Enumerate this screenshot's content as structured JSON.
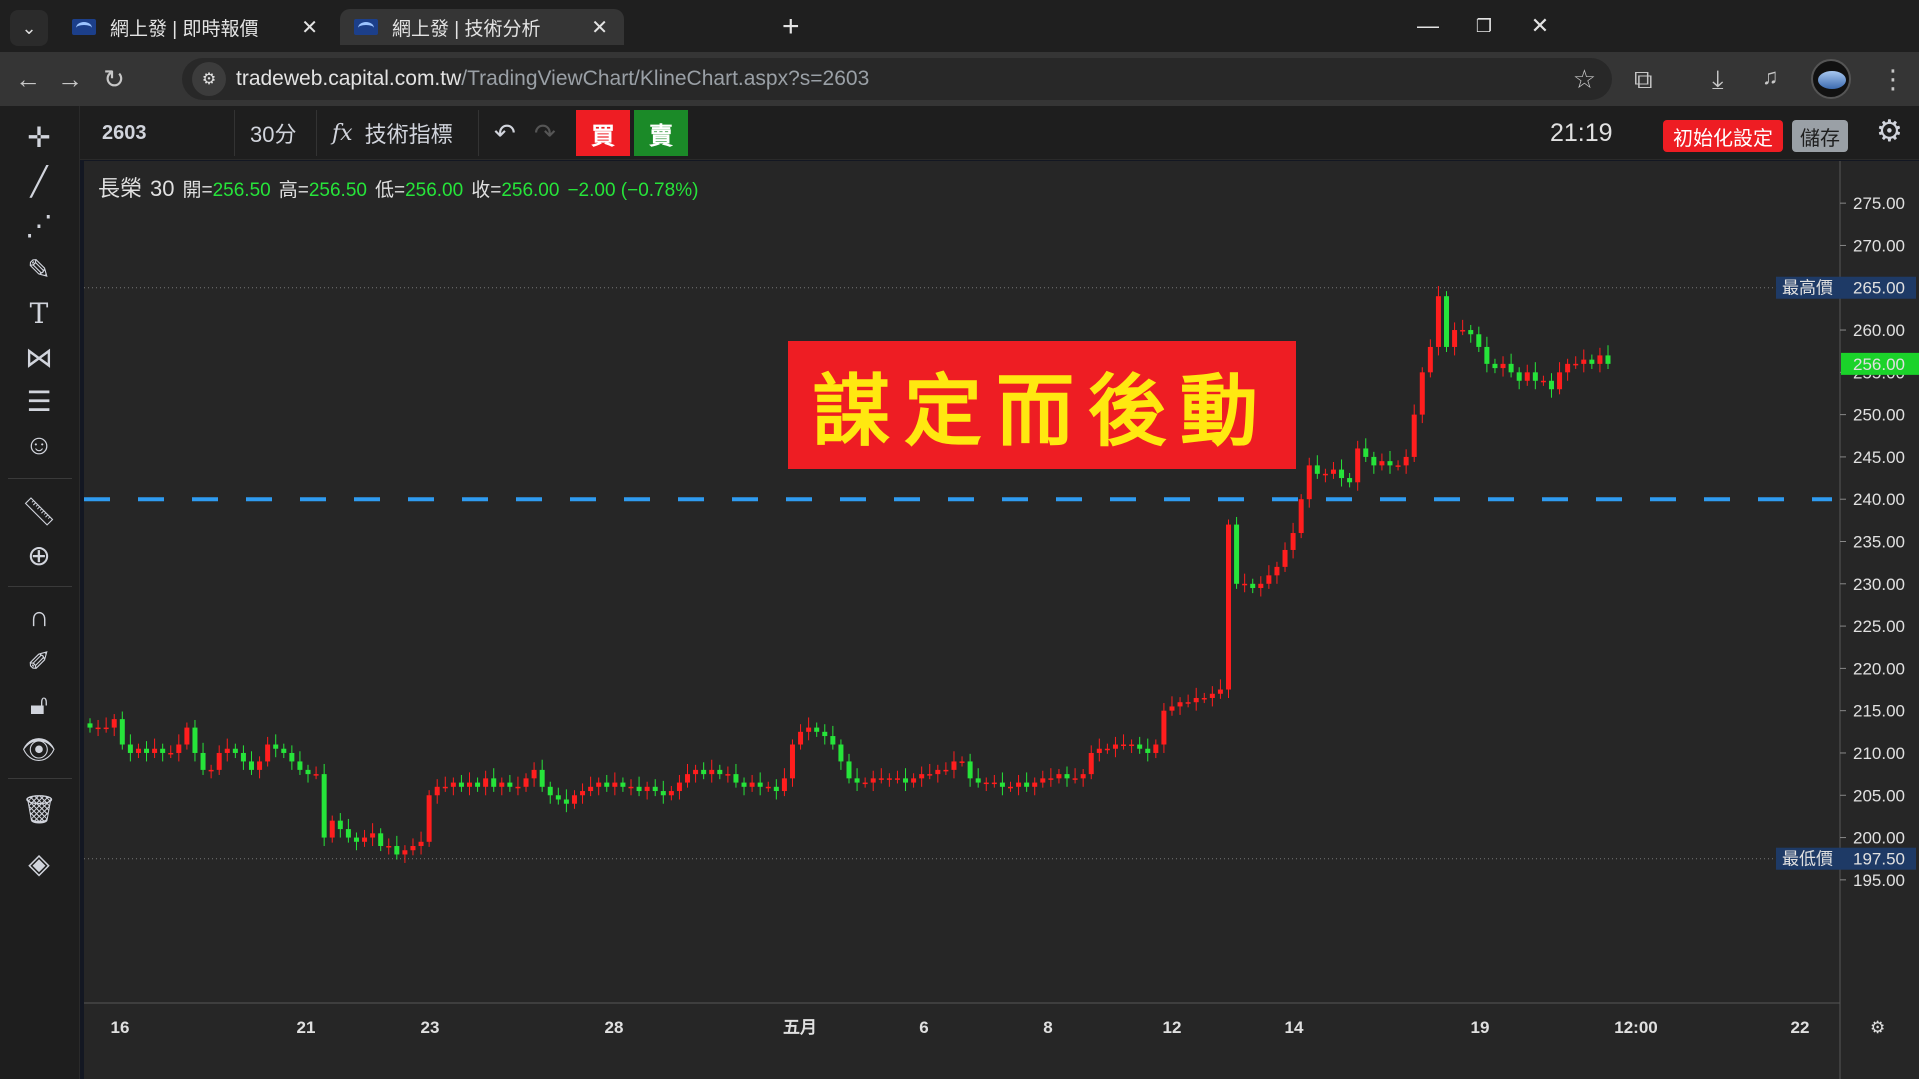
{
  "browser": {
    "tabs": [
      {
        "title": "網上發 | 即時報價",
        "active": false
      },
      {
        "title": "網上發 | 技術分析",
        "active": true
      }
    ],
    "url_host": "tradeweb.capital.com.tw",
    "url_path": "/TradingViewChart/KlineChart.aspx?s=2603"
  },
  "toolbar": {
    "symbol": "2603",
    "interval": "30分",
    "indicators_label": "技術指標",
    "buy_label": "買",
    "sell_label": "賣",
    "time": "21:19",
    "reset_label": "初始化設定",
    "save_label": "儲存"
  },
  "legend": {
    "name": "長榮",
    "interval": "30",
    "open_label": "開=",
    "open": "256.50",
    "high_label": "高=",
    "high": "256.50",
    "low_label": "低=",
    "low": "256.00",
    "close_label": "收=",
    "close": "256.00",
    "change": "−2.00 (−0.78%)"
  },
  "banner": "謀定而後動",
  "colors": {
    "up": "#ff1e1e",
    "down": "#26e43a",
    "hline": "#2f9bf0",
    "banner_bg": "#ee1d23",
    "banner_text": "#ffe810"
  },
  "chart_data": {
    "type": "candlestick",
    "ylim": [
      192.5,
      277.5
    ],
    "y_ticks": [
      "275.00",
      "270.00",
      "265.00",
      "260.00",
      "255.00",
      "250.00",
      "245.00",
      "240.00",
      "235.00",
      "230.00",
      "225.00",
      "220.00",
      "215.00",
      "210.00",
      "205.00",
      "200.00",
      "195.00"
    ],
    "x_ticks": [
      "16",
      "21",
      "23",
      "28",
      "五月",
      "6",
      "8",
      "12",
      "14",
      "19",
      "12:00",
      "22"
    ],
    "high_marker": {
      "label": "最高價",
      "value": "265.00"
    },
    "low_marker": {
      "label": "最低價",
      "value": "197.50"
    },
    "last_price": "256.00",
    "horizontal_line": 240.0,
    "series_close": [
      213,
      213,
      213,
      214,
      211,
      210,
      210.5,
      210,
      210.5,
      210,
      210,
      211,
      213,
      210,
      208,
      208,
      210,
      210.5,
      210,
      209,
      208,
      209,
      211,
      210.5,
      210,
      209,
      208,
      207.5,
      207.5,
      200,
      202,
      201,
      200,
      199.5,
      200,
      200.5,
      199,
      199,
      198,
      198.5,
      199,
      199.5,
      205,
      206,
      206,
      206.5,
      206,
      206.5,
      206,
      207,
      206,
      206.5,
      206,
      206,
      207,
      208,
      206,
      205,
      204.5,
      204,
      205,
      205.5,
      206,
      206.5,
      206,
      206.5,
      206,
      206,
      205.5,
      206,
      205.5,
      205,
      205.5,
      206.5,
      207.5,
      208,
      207.5,
      208,
      207.5,
      207.5,
      206.5,
      206,
      206.5,
      206,
      206,
      205.5,
      207,
      211,
      212.5,
      213,
      212.5,
      212,
      211,
      209,
      207,
      206.5,
      206.5,
      207,
      207,
      207,
      207,
      206.5,
      207,
      207.5,
      207.5,
      208,
      208,
      209,
      209,
      207,
      206.5,
      206.5,
      206.5,
      206,
      206,
      206.5,
      206,
      206.5,
      207,
      207,
      207.5,
      207,
      207,
      207.5,
      210,
      210.5,
      210.5,
      211,
      211,
      211,
      210.5,
      210,
      211,
      215,
      215.5,
      216,
      216,
      216.5,
      216.5,
      217,
      217.5,
      237,
      230,
      230,
      229.5,
      230,
      231,
      232,
      234,
      236,
      240,
      244,
      243,
      243,
      243.5,
      242.5,
      242,
      246,
      245,
      244,
      244.5,
      244,
      244,
      245,
      250,
      255,
      258,
      264,
      258,
      260,
      260,
      259.5,
      258,
      256,
      255.5,
      256,
      255,
      254,
      255,
      254,
      254,
      253,
      255,
      256,
      256,
      256.5,
      256,
      257,
      256
    ]
  }
}
